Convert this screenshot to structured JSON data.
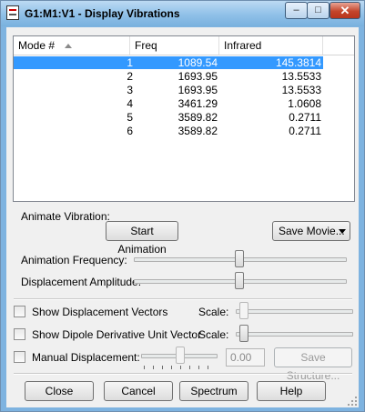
{
  "window": {
    "title": "G1:M1:V1 - Display Vibrations",
    "minimize": "–",
    "maximize": "□",
    "close": "✕"
  },
  "table": {
    "headers": {
      "mode": "Mode #",
      "freq": "Freq",
      "infrared": "Infrared"
    },
    "rows": [
      {
        "mode": "1",
        "freq": "1089.54",
        "infrared": "145.3814"
      },
      {
        "mode": "2",
        "freq": "1693.95",
        "infrared": "13.5533"
      },
      {
        "mode": "3",
        "freq": "1693.95",
        "infrared": "13.5533"
      },
      {
        "mode": "4",
        "freq": "3461.29",
        "infrared": "1.0608"
      },
      {
        "mode": "5",
        "freq": "3589.82",
        "infrared": "0.2711"
      },
      {
        "mode": "6",
        "freq": "3589.82",
        "infrared": "0.2711"
      }
    ],
    "selected_row": 0
  },
  "animate": {
    "section_label": "Animate Vibration:",
    "start_button": "Start Animation",
    "save_movie_button": "Save Movie...",
    "frequency_label": "Animation Frequency:",
    "frequency_level": 0.5,
    "amplitude_label": "Displacement Amplitude:",
    "amplitude_level": 0.5
  },
  "options": {
    "show_vectors_label": "Show Displacement Vectors",
    "show_vectors_checked": false,
    "show_dipole_label": "Show Dipole Derivative Unit Vector",
    "show_dipole_checked": false,
    "scale_label": "Scale:",
    "manual_label": "Manual Displacement:",
    "manual_checked": false,
    "manual_value": "0.00",
    "save_structure_button": "Save Structure..."
  },
  "footer": {
    "close": "Close",
    "cancel": "Cancel",
    "spectrum": "Spectrum",
    "help": "Help"
  },
  "icons": [
    "app-icon",
    "sort-ascending-icon",
    "dropdown-arrow-icon",
    "resize-grip-icon"
  ]
}
